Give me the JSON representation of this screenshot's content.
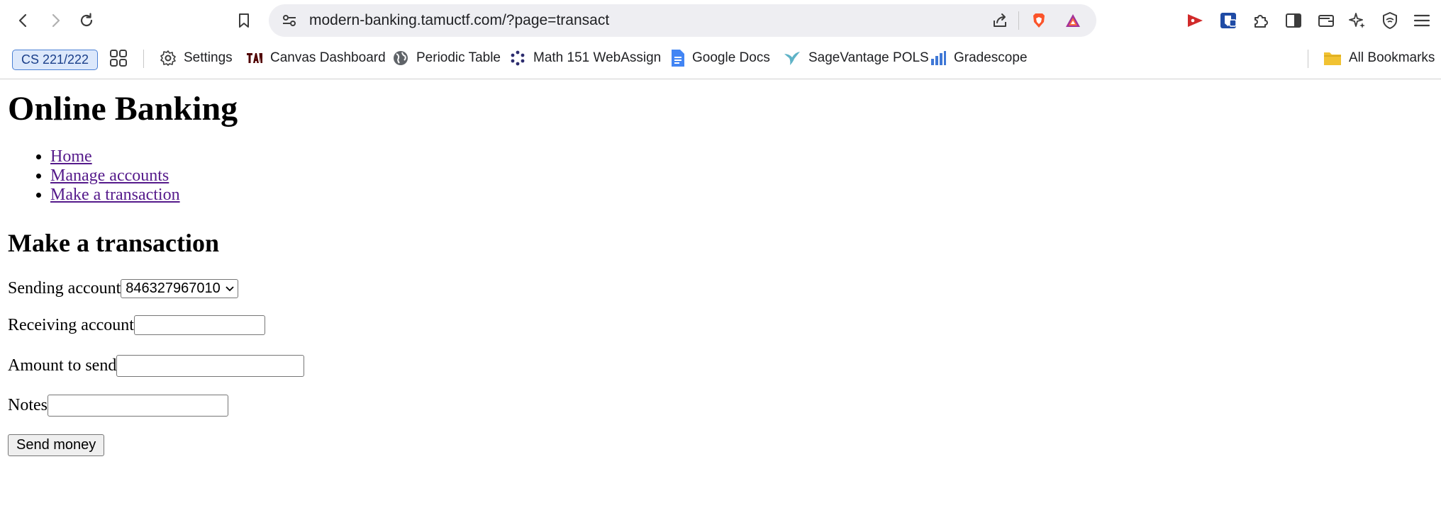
{
  "browser": {
    "url": "modern-banking.tamuctf.com/?page=transact",
    "bookmarks": [
      {
        "label": "CS 221/222",
        "icon": "tab-group-chip"
      },
      {
        "label": "Settings",
        "icon": "gear-icon"
      },
      {
        "label": "Canvas Dashboard",
        "icon": "tamu-logo-icon"
      },
      {
        "label": "Periodic Table",
        "icon": "globe-icon"
      },
      {
        "label": "Math 151 WebAssign",
        "icon": "webassign-icon"
      },
      {
        "label": "Google Docs",
        "icon": "docs-icon"
      },
      {
        "label": "SageVantage POLS",
        "icon": "bird-icon"
      },
      {
        "label": "Gradescope",
        "icon": "bar-chart-icon"
      },
      {
        "label": "All Bookmarks",
        "icon": "folder-icon"
      }
    ],
    "colors": {
      "brave": "#fb542b",
      "accent": "#4a7fd4"
    }
  },
  "page": {
    "title": "Online Banking",
    "nav": [
      "Home",
      "Manage accounts",
      "Make a transaction"
    ],
    "heading": "Make a transaction",
    "form": {
      "sending_label": "Sending account",
      "sending_value": "846327967010",
      "receiving_label": "Receiving account",
      "amount_label": "Amount to send",
      "notes_label": "Notes",
      "submit_label": "Send money"
    }
  }
}
